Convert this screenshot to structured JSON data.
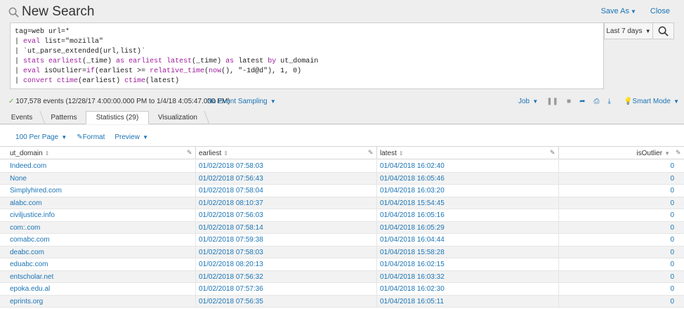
{
  "header": {
    "title": "New Search",
    "save_as": "Save As",
    "close": "Close"
  },
  "search": {
    "lines": [
      [
        {
          "t": "tag=web url=*",
          "c": "str"
        }
      ],
      [
        {
          "t": "| ",
          "c": "str"
        },
        {
          "t": "eval",
          "c": "kw"
        },
        {
          "t": " list=\"mozilla\"",
          "c": "str"
        }
      ],
      [
        {
          "t": "| `ut_parse_extended(url,list)`",
          "c": "str"
        }
      ],
      [
        {
          "t": "| ",
          "c": "str"
        },
        {
          "t": "stats",
          "c": "kw"
        },
        {
          "t": " ",
          "c": "str"
        },
        {
          "t": "earliest",
          "c": "fn"
        },
        {
          "t": "(_time) ",
          "c": "str"
        },
        {
          "t": "as",
          "c": "kw"
        },
        {
          "t": " ",
          "c": "str"
        },
        {
          "t": "earliest",
          "c": "fn"
        },
        {
          "t": " ",
          "c": "str"
        },
        {
          "t": "latest",
          "c": "fn"
        },
        {
          "t": "(_time) ",
          "c": "str"
        },
        {
          "t": "as",
          "c": "kw"
        },
        {
          "t": " latest ",
          "c": "str"
        },
        {
          "t": "by",
          "c": "kw"
        },
        {
          "t": " ut_domain",
          "c": "str"
        }
      ],
      [
        {
          "t": "| ",
          "c": "str"
        },
        {
          "t": "eval",
          "c": "kw"
        },
        {
          "t": " isOutlier=",
          "c": "str"
        },
        {
          "t": "if",
          "c": "fn"
        },
        {
          "t": "(earliest >= ",
          "c": "str"
        },
        {
          "t": "relative_time",
          "c": "fn"
        },
        {
          "t": "(",
          "c": "str"
        },
        {
          "t": "now",
          "c": "fn"
        },
        {
          "t": "(), \"-1d@d\"), 1, 0)",
          "c": "str"
        }
      ],
      [
        {
          "t": "| ",
          "c": "str"
        },
        {
          "t": "convert",
          "c": "kw"
        },
        {
          "t": " ",
          "c": "str"
        },
        {
          "t": "ctime",
          "c": "fn"
        },
        {
          "t": "(earliest) ",
          "c": "str"
        },
        {
          "t": "ctime",
          "c": "fn"
        },
        {
          "t": "(latest)",
          "c": "str"
        }
      ]
    ],
    "time_range": "Last 7 days"
  },
  "status": {
    "events": "107,578 events (12/28/17 4:00:00.000 PM to 1/4/18 4:05:47.000 PM)",
    "sampling": "No Event Sampling",
    "job": "Job",
    "mode": "Smart Mode"
  },
  "tabs": [
    {
      "label": "Events"
    },
    {
      "label": "Patterns"
    },
    {
      "label": "Statistics (29)"
    },
    {
      "label": "Visualization"
    }
  ],
  "toolbar": {
    "per_page": "100 Per Page",
    "format": "Format",
    "preview": "Preview"
  },
  "table": {
    "columns": [
      "ut_domain",
      "earliest",
      "latest",
      "isOutlier"
    ],
    "rows": [
      [
        "Indeed.com",
        "01/02/2018 07:58:03",
        "01/04/2018 16:02:40",
        "0"
      ],
      [
        "None",
        "01/02/2018 07:56:43",
        "01/04/2018 16:05:46",
        "0"
      ],
      [
        "Simplyhired.com",
        "01/02/2018 07:58:04",
        "01/04/2018 16:03:20",
        "0"
      ],
      [
        "alabc.com",
        "01/02/2018 08:10:37",
        "01/04/2018 15:54:45",
        "0"
      ],
      [
        "civiljustice.info",
        "01/02/2018 07:56:03",
        "01/04/2018 16:05:16",
        "0"
      ],
      [
        "com:.com",
        "01/02/2018 07:58:14",
        "01/04/2018 16:05:29",
        "0"
      ],
      [
        "comabc.com",
        "01/02/2018 07:59:38",
        "01/04/2018 16:04:44",
        "0"
      ],
      [
        "deabc.com",
        "01/02/2018 07:58:03",
        "01/04/2018 15:58:28",
        "0"
      ],
      [
        "eduabc.com",
        "01/02/2018 08:20:13",
        "01/04/2018 16:02:15",
        "0"
      ],
      [
        "entscholar.net",
        "01/02/2018 07:56:32",
        "01/04/2018 16:03:32",
        "0"
      ],
      [
        "epoka.edu.al",
        "01/02/2018 07:57:36",
        "01/04/2018 16:02:30",
        "0"
      ],
      [
        "eprints.org",
        "01/02/2018 07:56:35",
        "01/04/2018 16:05:11",
        "0"
      ]
    ]
  }
}
